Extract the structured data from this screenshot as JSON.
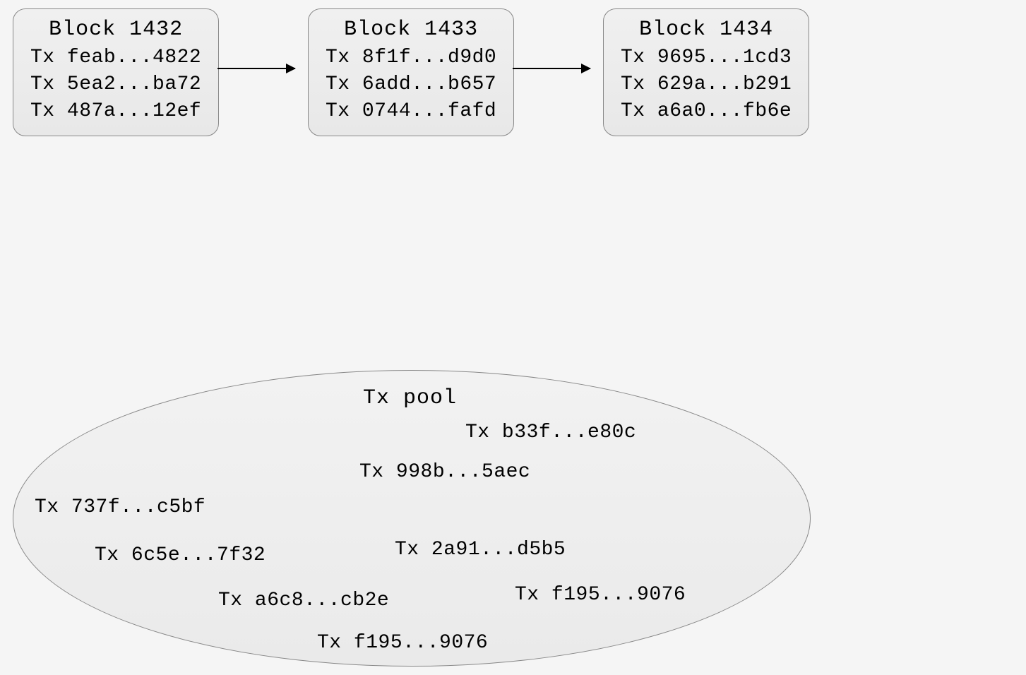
{
  "blocks": [
    {
      "title": "Block 1432",
      "txs": [
        "Tx feab...4822",
        "Tx 5ea2...ba72",
        "Tx 487a...12ef"
      ]
    },
    {
      "title": "Block 1433",
      "txs": [
        "Tx 8f1f...d9d0",
        "Tx 6add...b657",
        "Tx 0744...fafd"
      ]
    },
    {
      "title": "Block 1434",
      "txs": [
        "Tx 9695...1cd3",
        "Tx 629a...b291",
        "Tx a6a0...fb6e"
      ]
    }
  ],
  "pool": {
    "title": "Tx pool",
    "txs": [
      "Tx b33f...e80c",
      "Tx 998b...5aec",
      "Tx 737f...c5bf",
      "Tx 6c5e...7f32",
      "Tx 2a91...d5b5",
      "Tx a6c8...cb2e",
      "Tx f195...9076",
      "Tx f195...9076"
    ]
  }
}
